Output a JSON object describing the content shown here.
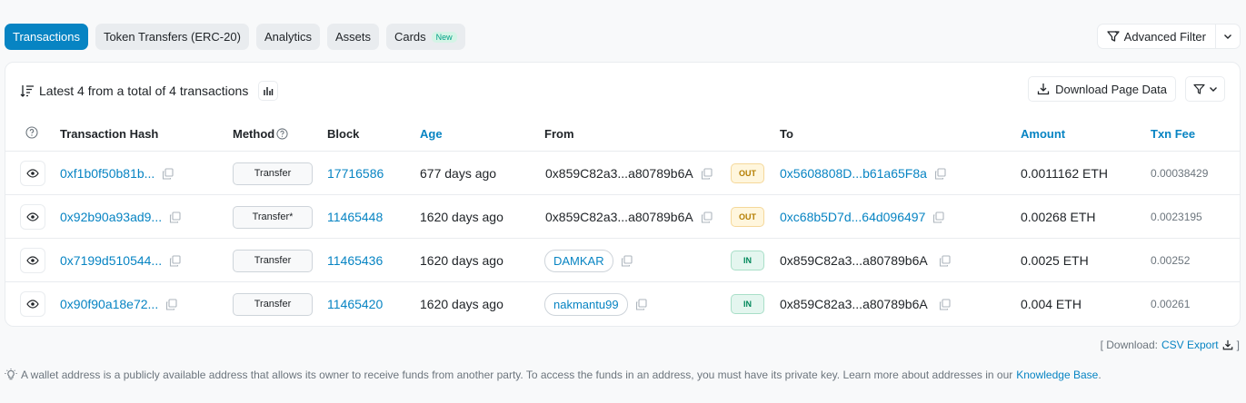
{
  "tabs": [
    {
      "label": "Transactions",
      "active": true
    },
    {
      "label": "Token Transfers (ERC-20)"
    },
    {
      "label": "Analytics"
    },
    {
      "label": "Assets"
    },
    {
      "label": "Cards",
      "badge": "New"
    }
  ],
  "advanced_filter": {
    "label": "Advanced Filter"
  },
  "summary": {
    "text": "Latest 4 from a total of 4 transactions"
  },
  "download": {
    "label": "Download Page Data"
  },
  "columns": {
    "hash": "Transaction Hash",
    "method": "Method",
    "block": "Block",
    "age": "Age",
    "from": "From",
    "to": "To",
    "amount": "Amount",
    "fee": "Txn Fee"
  },
  "rows": [
    {
      "hash": "0xf1b0f50b81b...",
      "method": "Transfer",
      "block": "17716586",
      "age": "677 days ago",
      "from": "0x859C82a3...a80789b6A",
      "direction": "OUT",
      "to": "0x5608808D...b61a65F8a",
      "amount": "0.0011162 ETH",
      "fee": "0.00038429"
    },
    {
      "hash": "0x92b90a93ad9...",
      "method": "Transfer*",
      "block": "11465448",
      "age": "1620 days ago",
      "from": "0x859C82a3...a80789b6A",
      "direction": "OUT",
      "to": "0xc68b5D7d...64d096497",
      "amount": "0.00268 ETH",
      "fee": "0.0023195"
    },
    {
      "hash": "0x7199d510544...",
      "method": "Transfer",
      "block": "11465436",
      "age": "1620 days ago",
      "from": "DAMKAR",
      "direction": "IN",
      "to": "0x859C82a3...a80789b6A",
      "amount": "0.0025 ETH",
      "fee": "0.00252"
    },
    {
      "hash": "0x90f90a18e72...",
      "method": "Transfer",
      "block": "11465420",
      "age": "1620 days ago",
      "from": "nakmantu99",
      "direction": "IN",
      "to": "0x859C82a3...a80789b6A",
      "amount": "0.004 ETH",
      "fee": "0.00261"
    }
  ],
  "csv": {
    "prefix": "[ Download:",
    "link": "CSV Export",
    "suffix": "]"
  },
  "footer": {
    "text": "A wallet address is a publicly available address that allows its owner to receive funds from another party. To access the funds in an address, you must have its private key. Learn more about addresses in our",
    "link": "Knowledge Base",
    "end": "."
  },
  "colors": {
    "accent": "#0784c3",
    "out_badge": "#fff6dd",
    "in_badge": "#e4f6ef"
  }
}
